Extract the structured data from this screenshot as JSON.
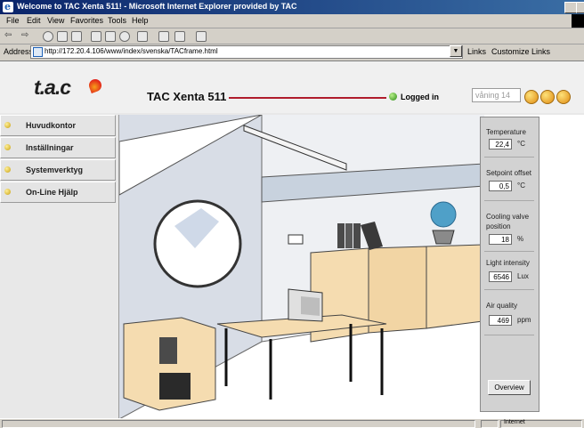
{
  "window": {
    "title": "Welcome to TAC Xenta 511! - Microsoft Internet Explorer provided by TAC",
    "ie_icon": "e"
  },
  "menu": [
    "File",
    "Edit",
    "View",
    "Favorites",
    "Tools",
    "Help"
  ],
  "address": {
    "label": "Address",
    "url": "http://172.20.4.106/www/index/svenska/TACframe.html",
    "links_label": "Links",
    "customize_label": "Customize Links"
  },
  "header": {
    "logo": "t.a.c",
    "product": "TAC Xenta 511",
    "login_status": "Logged in",
    "user_field": "våning 14"
  },
  "sidebar": {
    "items": [
      {
        "label": "Huvudkontor"
      },
      {
        "label": "Inställningar"
      },
      {
        "label": "Systemverktyg"
      },
      {
        "label": "On-Line Hjälp"
      }
    ]
  },
  "readouts": {
    "temperature": {
      "label": "Temperature",
      "value": "22,4",
      "unit": "°C"
    },
    "setpoint": {
      "label": "Setpoint offset",
      "value": "0,5",
      "unit": "°C"
    },
    "cooling": {
      "label1": "Cooling valve",
      "label2": "position",
      "value": "18",
      "unit": "%"
    },
    "light": {
      "label": "Light intensity",
      "value": "6546",
      "unit": "Lux"
    },
    "air": {
      "label": "Air quality",
      "value": "469",
      "unit": "ppm"
    },
    "overview_label": "Overview"
  },
  "status": {
    "zone": "Internet"
  },
  "colors": {
    "accent_line": "#b01c2c",
    "logged_in": "#2a8a14",
    "titlebar": "#0a246a"
  }
}
